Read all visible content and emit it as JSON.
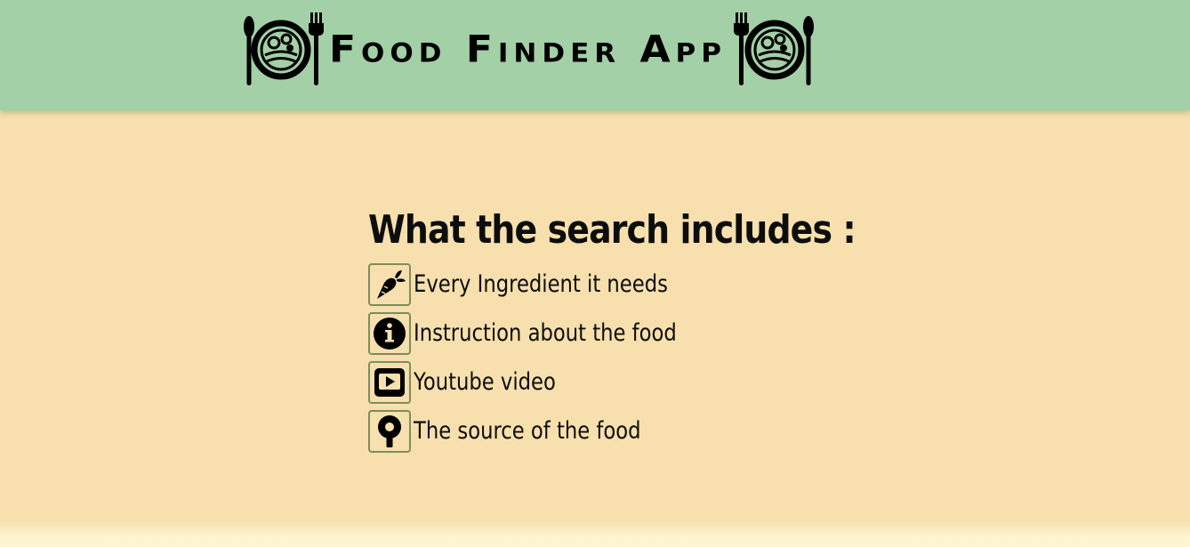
{
  "header": {
    "title": "Food Finder App",
    "background_color": "#a3d0a6",
    "left_logo_icon": "plate-fork-spoon-icon",
    "right_logo_icon": "plate-fork-spoon-icon"
  },
  "main": {
    "heading": "What the search includes :",
    "background_color": "#f7e0ad",
    "features": [
      {
        "icon": "carrot-icon",
        "label": "Every Ingredient it needs"
      },
      {
        "icon": "info-circle-icon",
        "label": "Instruction about the food"
      },
      {
        "icon": "youtube-play-icon",
        "label": "Youtube video"
      },
      {
        "icon": "location-pin-icon",
        "label": "The source of the food"
      }
    ]
  }
}
